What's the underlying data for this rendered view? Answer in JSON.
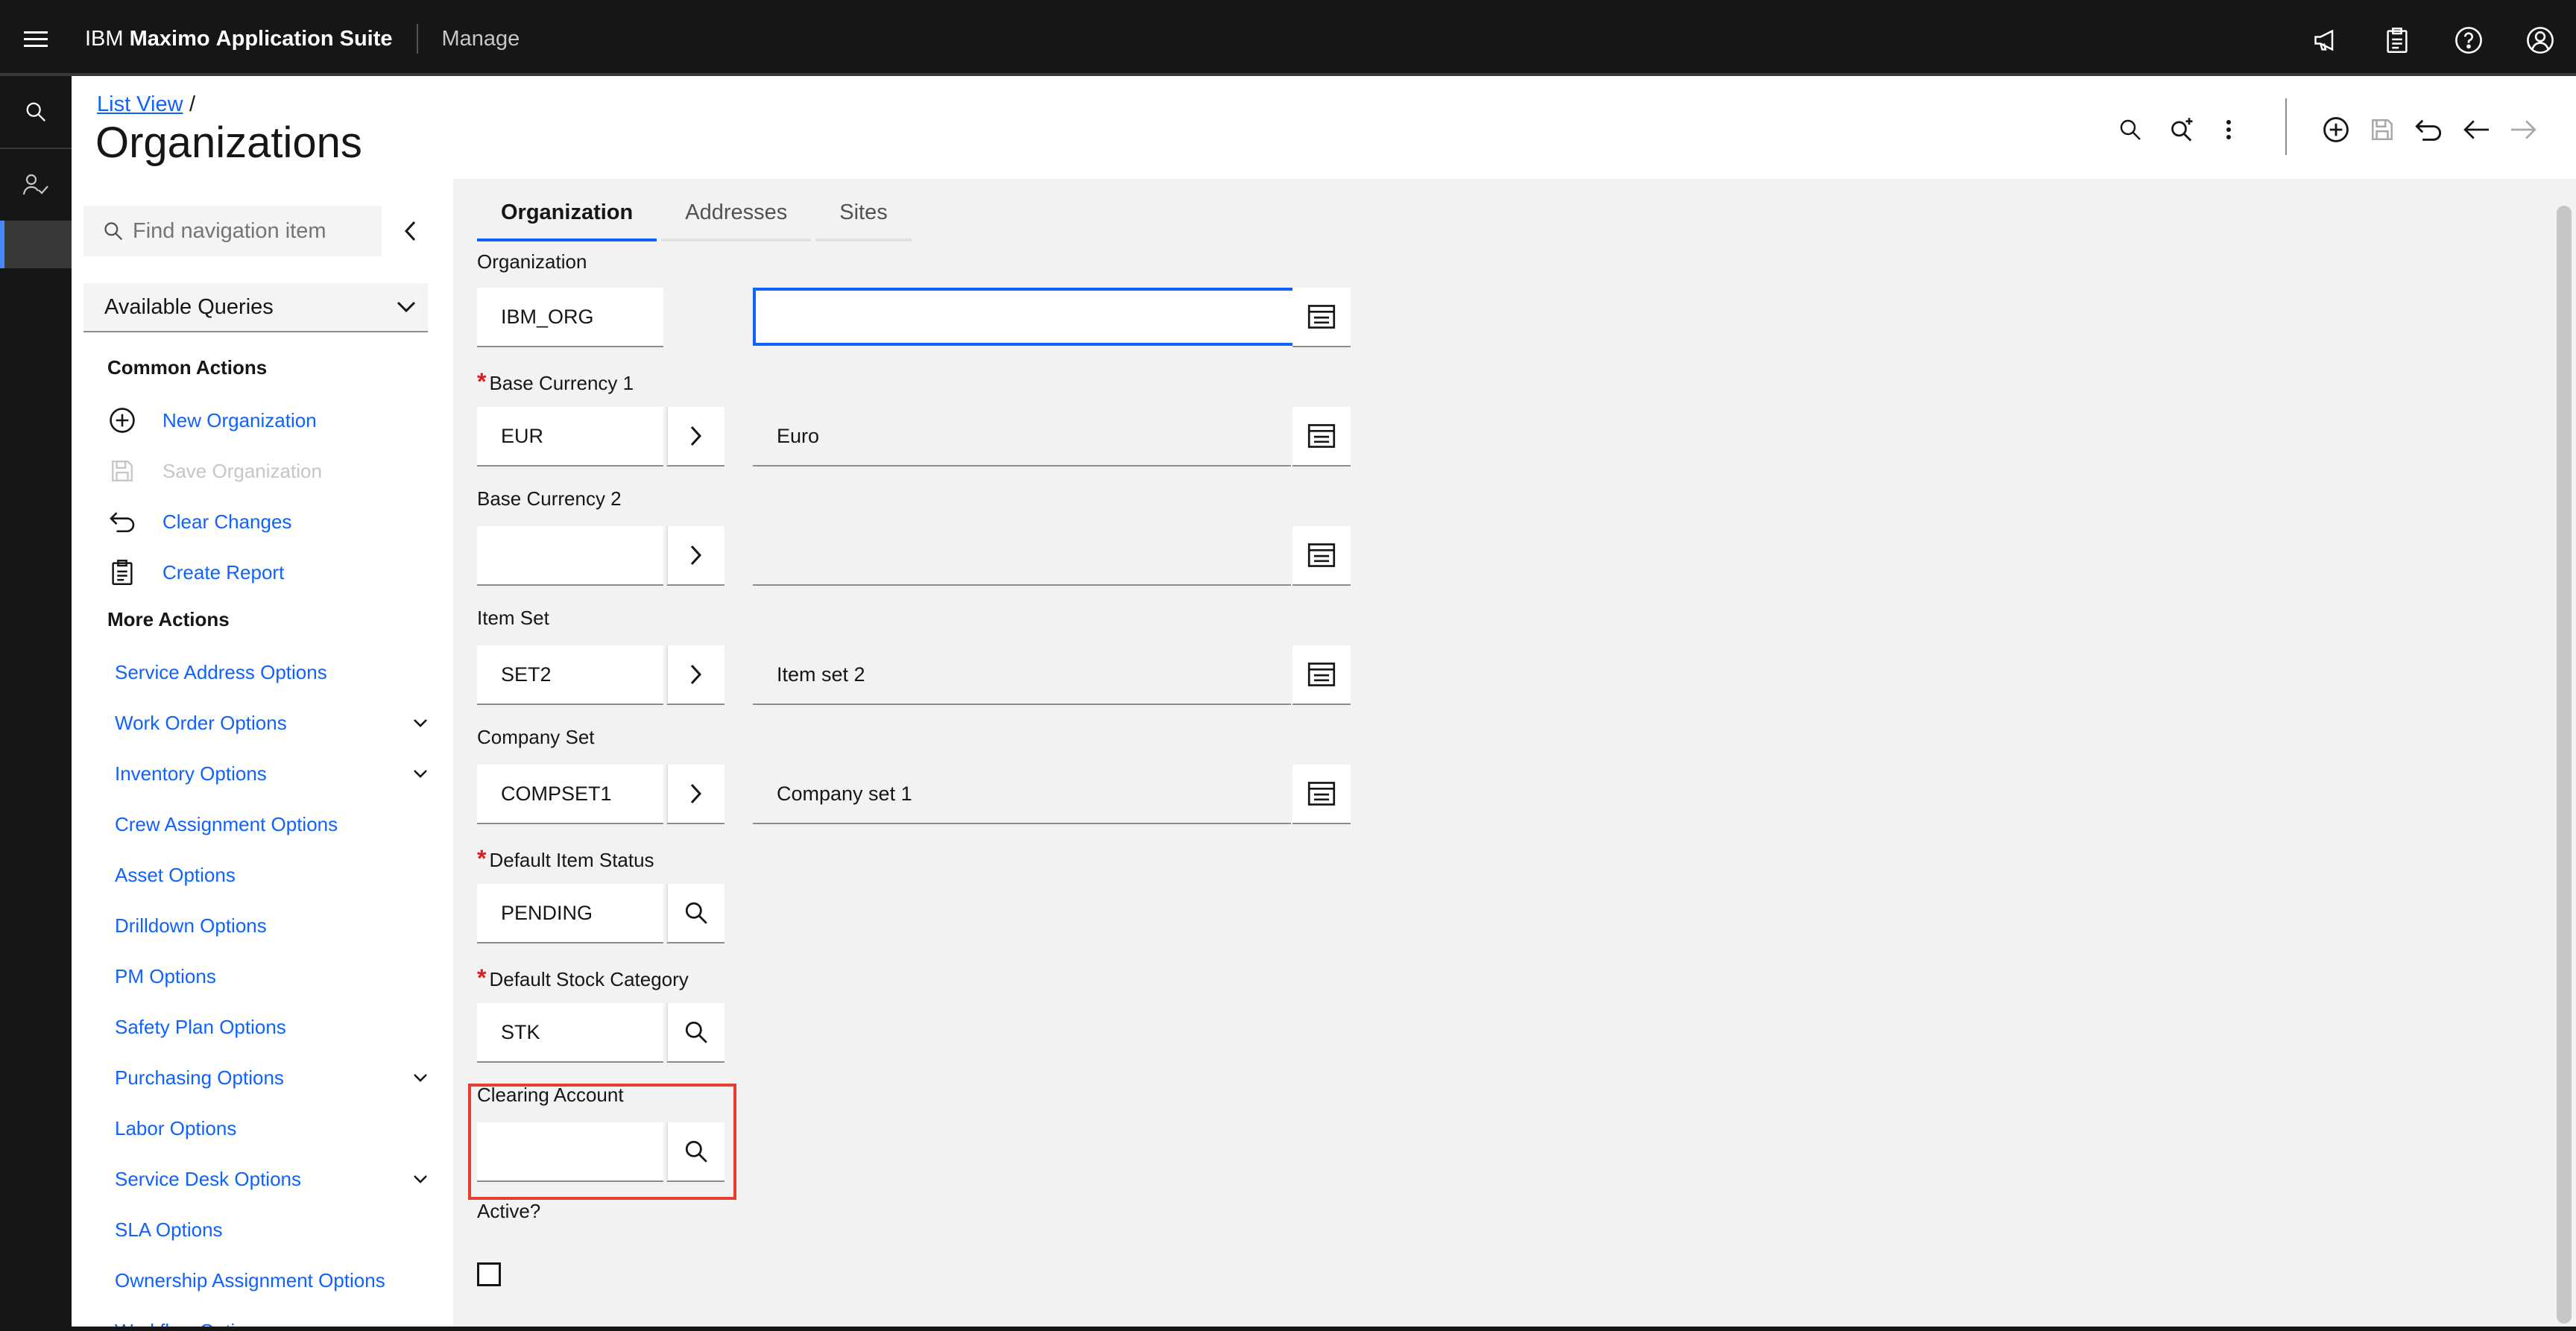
{
  "app": {
    "brand_prefix": "IBM",
    "brand_bold": "Maximo",
    "brand_rest": "Application Suite",
    "module": "Manage"
  },
  "header": {
    "breadcrumb": "List View",
    "breadcrumb_sep": "/",
    "title": "Organizations"
  },
  "sidebar": {
    "search_placeholder": "Find navigation item",
    "queries_label": "Available Queries",
    "common_title": "Common Actions",
    "common": [
      {
        "label": "New Organization",
        "icon": "add-circle-icon",
        "enabled": true
      },
      {
        "label": "Save Organization",
        "icon": "save-icon",
        "enabled": false
      },
      {
        "label": "Clear Changes",
        "icon": "undo-icon",
        "enabled": true
      },
      {
        "label": "Create Report",
        "icon": "report-icon",
        "enabled": true
      }
    ],
    "more_title": "More Actions",
    "more": [
      {
        "label": "Service Address Options",
        "expandable": false
      },
      {
        "label": "Work Order Options",
        "expandable": true
      },
      {
        "label": "Inventory Options",
        "expandable": true
      },
      {
        "label": "Crew Assignment Options",
        "expandable": false
      },
      {
        "label": "Asset Options",
        "expandable": false
      },
      {
        "label": "Drilldown Options",
        "expandable": false
      },
      {
        "label": "PM Options",
        "expandable": false
      },
      {
        "label": "Safety Plan Options",
        "expandable": false
      },
      {
        "label": "Purchasing Options",
        "expandable": true
      },
      {
        "label": "Labor Options",
        "expandable": false
      },
      {
        "label": "Service Desk Options",
        "expandable": true
      },
      {
        "label": "SLA Options",
        "expandable": false
      },
      {
        "label": "Ownership Assignment Options",
        "expandable": false
      },
      {
        "label": "Workflow Options",
        "expandable": false
      }
    ]
  },
  "tabs": [
    "Organization",
    "Addresses",
    "Sites"
  ],
  "form": {
    "organization": {
      "label": "Organization",
      "value": "IBM_ORG",
      "description": ""
    },
    "base_currency_1": {
      "label": "Base Currency 1",
      "required": "*",
      "value": "EUR",
      "description": "Euro"
    },
    "base_currency_2": {
      "label": "Base Currency 2",
      "value": "",
      "description": ""
    },
    "item_set": {
      "label": "Item Set",
      "value": "SET2",
      "description": "Item set 2"
    },
    "company_set": {
      "label": "Company Set",
      "value": "COMPSET1",
      "description": "Company set 1"
    },
    "default_item_status": {
      "label": "Default Item Status",
      "required": "*",
      "value": "PENDING"
    },
    "default_stock_category": {
      "label": "Default Stock Category",
      "required": "*",
      "value": "STK"
    },
    "clearing_account": {
      "label": "Clearing Account",
      "value": ""
    },
    "active": {
      "label": "Active?",
      "checked": false
    }
  },
  "colors": {
    "accent": "#0f62fe",
    "required": "#da1e28",
    "highlight": "#e53e2f",
    "topbar": "#161616"
  }
}
